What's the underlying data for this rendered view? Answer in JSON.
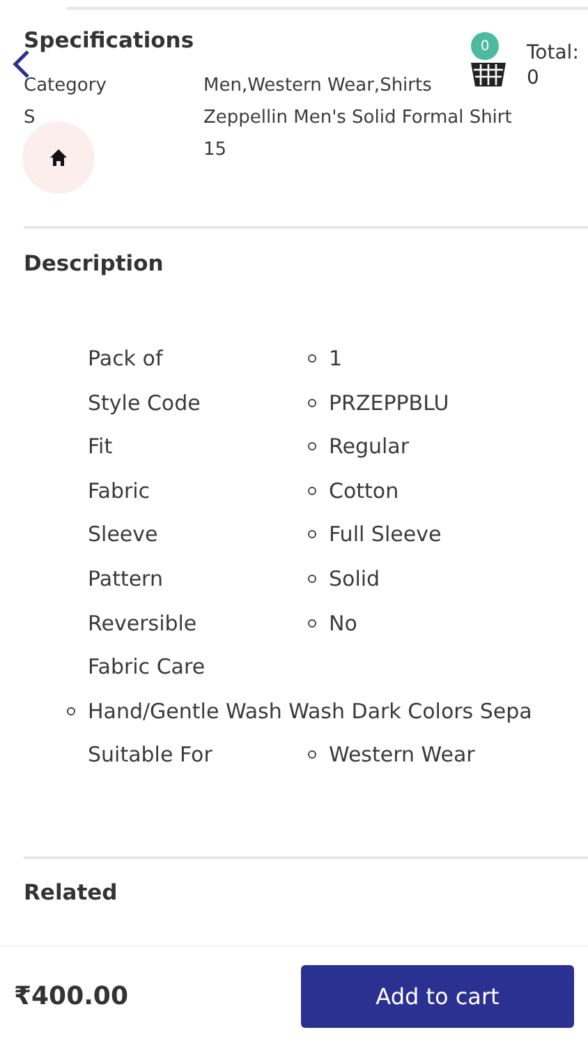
{
  "cart": {
    "count": "0",
    "total_label": "Total:",
    "total_value": "0"
  },
  "specifications": {
    "title": "Specifications",
    "rows": [
      {
        "label": "Category",
        "value": "Men,Western Wear,Shirts"
      },
      {
        "label": "S",
        "value": "Zeppellin Men's Solid Formal Shirt"
      },
      {
        "value": "15"
      }
    ]
  },
  "description": {
    "title": "Description",
    "items": [
      {
        "kind": "pair",
        "label": "Pack of",
        "value": "1"
      },
      {
        "kind": "pair",
        "label": "Style Code",
        "value": "PRZEPPBLU"
      },
      {
        "kind": "pair",
        "label": "Fit",
        "value": "Regular"
      },
      {
        "kind": "pair",
        "label": "Fabric",
        "value": "Cotton"
      },
      {
        "kind": "pair",
        "label": "Sleeve",
        "value": "Full Sleeve"
      },
      {
        "kind": "pair",
        "label": "Pattern",
        "value": "Solid"
      },
      {
        "kind": "pair",
        "label": "Reversible",
        "value": "No"
      },
      {
        "kind": "heading",
        "label": "Fabric Care"
      },
      {
        "kind": "bullet",
        "text": "Hand/Gentle Wash Wash Dark Colors Sepa"
      },
      {
        "kind": "pair",
        "label": "Suitable For",
        "value": "Western Wear"
      }
    ]
  },
  "related": {
    "title": "Related"
  },
  "footer": {
    "price": "₹400.00",
    "button": "Add to cart"
  }
}
